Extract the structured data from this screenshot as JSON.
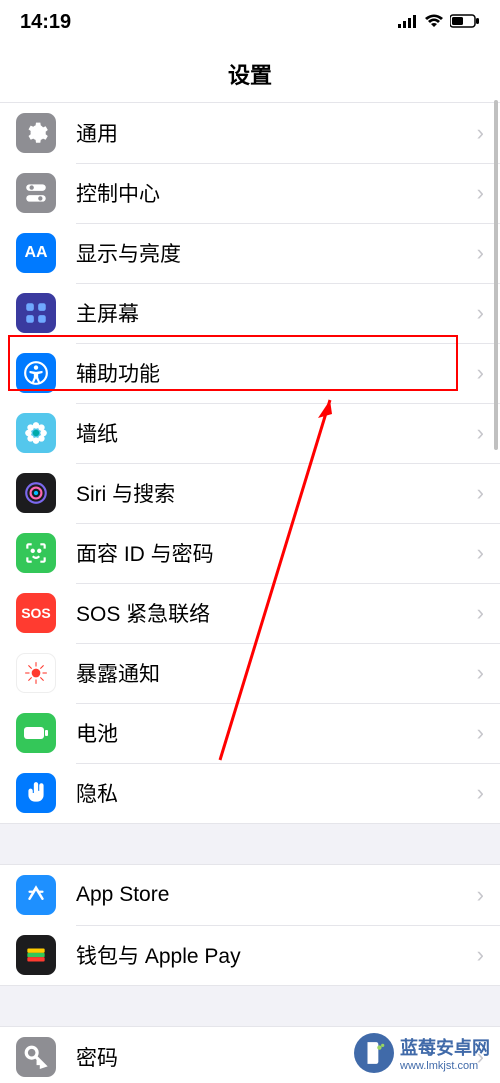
{
  "status": {
    "time": "14:19"
  },
  "header": {
    "title": "设置"
  },
  "groups": [
    {
      "items": [
        {
          "id": "general",
          "label": "通用",
          "icon": "gear-icon"
        },
        {
          "id": "control",
          "label": "控制中心",
          "icon": "toggles-icon"
        },
        {
          "id": "display",
          "label": "显示与亮度",
          "icon": "text-size-icon"
        },
        {
          "id": "home",
          "label": "主屏幕",
          "icon": "home-grid-icon"
        },
        {
          "id": "access",
          "label": "辅助功能",
          "icon": "accessibility-icon",
          "highlighted": true
        },
        {
          "id": "wall",
          "label": "墙纸",
          "icon": "flower-icon"
        },
        {
          "id": "siri",
          "label": "Siri 与搜索",
          "icon": "siri-icon"
        },
        {
          "id": "face",
          "label": "面容 ID 与密码",
          "icon": "faceid-icon"
        },
        {
          "id": "sos",
          "label": "SOS 紧急联络",
          "icon": "sos-icon"
        },
        {
          "id": "expose",
          "label": "暴露通知",
          "icon": "exposure-icon"
        },
        {
          "id": "battery",
          "label": "电池",
          "icon": "battery-icon"
        },
        {
          "id": "privacy",
          "label": "隐私",
          "icon": "hand-icon"
        }
      ]
    },
    {
      "items": [
        {
          "id": "appstore",
          "label": "App Store",
          "icon": "appstore-icon"
        },
        {
          "id": "wallet",
          "label": "钱包与 Apple Pay",
          "icon": "wallet-icon"
        }
      ]
    },
    {
      "items": [
        {
          "id": "password",
          "label": "密码",
          "icon": "key-icon"
        }
      ]
    }
  ],
  "watermark": {
    "text": "蓝莓安卓网",
    "url": "www.lmkjst.com"
  }
}
